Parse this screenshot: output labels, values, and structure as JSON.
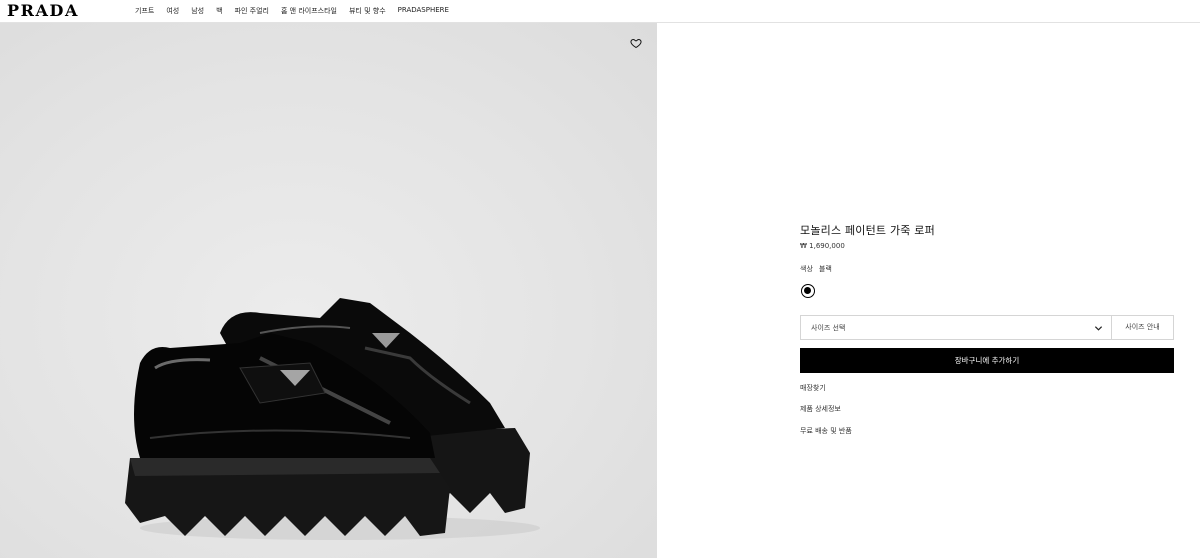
{
  "header": {
    "logo": "PRADA",
    "nav": [
      "기프트",
      "여성",
      "남성",
      "백",
      "파인 주얼리",
      "홈 앤 라이프스타일",
      "뷰티 및 향수",
      "PRADASPHERE"
    ]
  },
  "product": {
    "title": "모놀리스 페이턴트 가죽 로퍼",
    "price": "₩ 1,690,000",
    "color_label": "색상",
    "color_value": "블랙",
    "swatch_color": "#000000",
    "size_select_label": "사이즈 선택",
    "size_guide_label": "사이즈 안내",
    "add_to_cart_label": "장바구니에 추가하기",
    "links": [
      "매장찾기",
      "제품 상세정보",
      "무료 배송 및 반품"
    ]
  },
  "icons": {
    "wishlist": "heart-outline-icon",
    "dropdown": "chevron-down-icon"
  },
  "colors": {
    "image_background": "#e4e4e4",
    "cta_background": "#000000",
    "cta_text": "#ffffff",
    "border": "#d5d5d5"
  }
}
